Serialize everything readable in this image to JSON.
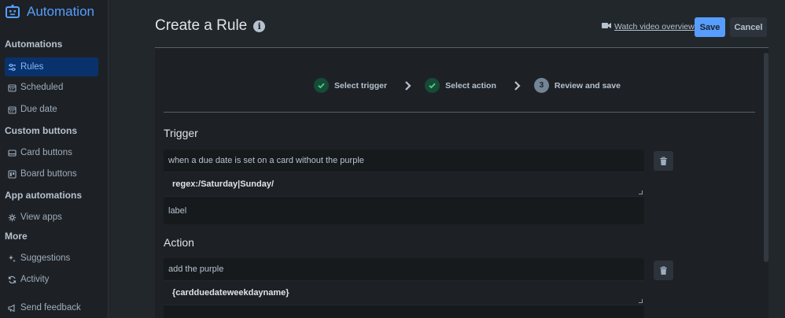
{
  "sidebar": {
    "brand": "Automation",
    "sections": {
      "automations": "Automations",
      "custom_buttons": "Custom buttons",
      "app_automations": "App automations",
      "more": "More"
    },
    "items": {
      "rules": "Rules",
      "scheduled": "Scheduled",
      "due_date": "Due date",
      "card_buttons": "Card buttons",
      "board_buttons": "Board buttons",
      "view_apps": "View apps",
      "suggestions": "Suggestions",
      "activity": "Activity",
      "send_feedback": "Send feedback"
    }
  },
  "header": {
    "title": "Create a Rule",
    "video_link": "Watch video overview",
    "save": "Save",
    "cancel": "Cancel"
  },
  "steps": [
    {
      "label": "Select trigger",
      "state": "done"
    },
    {
      "label": "Select action",
      "state": "done"
    },
    {
      "number": "3",
      "label": "Review and save",
      "state": "current"
    }
  ],
  "trigger": {
    "heading": "Trigger",
    "text": "when a due date is set on a card without the purple",
    "input": "regex:/Saturday|Sunday/",
    "suffix": "label"
  },
  "action": {
    "heading": "Action",
    "text": "add the purple",
    "input": "{cardduedateweekdayname}"
  },
  "colors": {
    "accent": "#579dff",
    "active_nav_bg": "#09326c",
    "success": "#4bce97"
  }
}
